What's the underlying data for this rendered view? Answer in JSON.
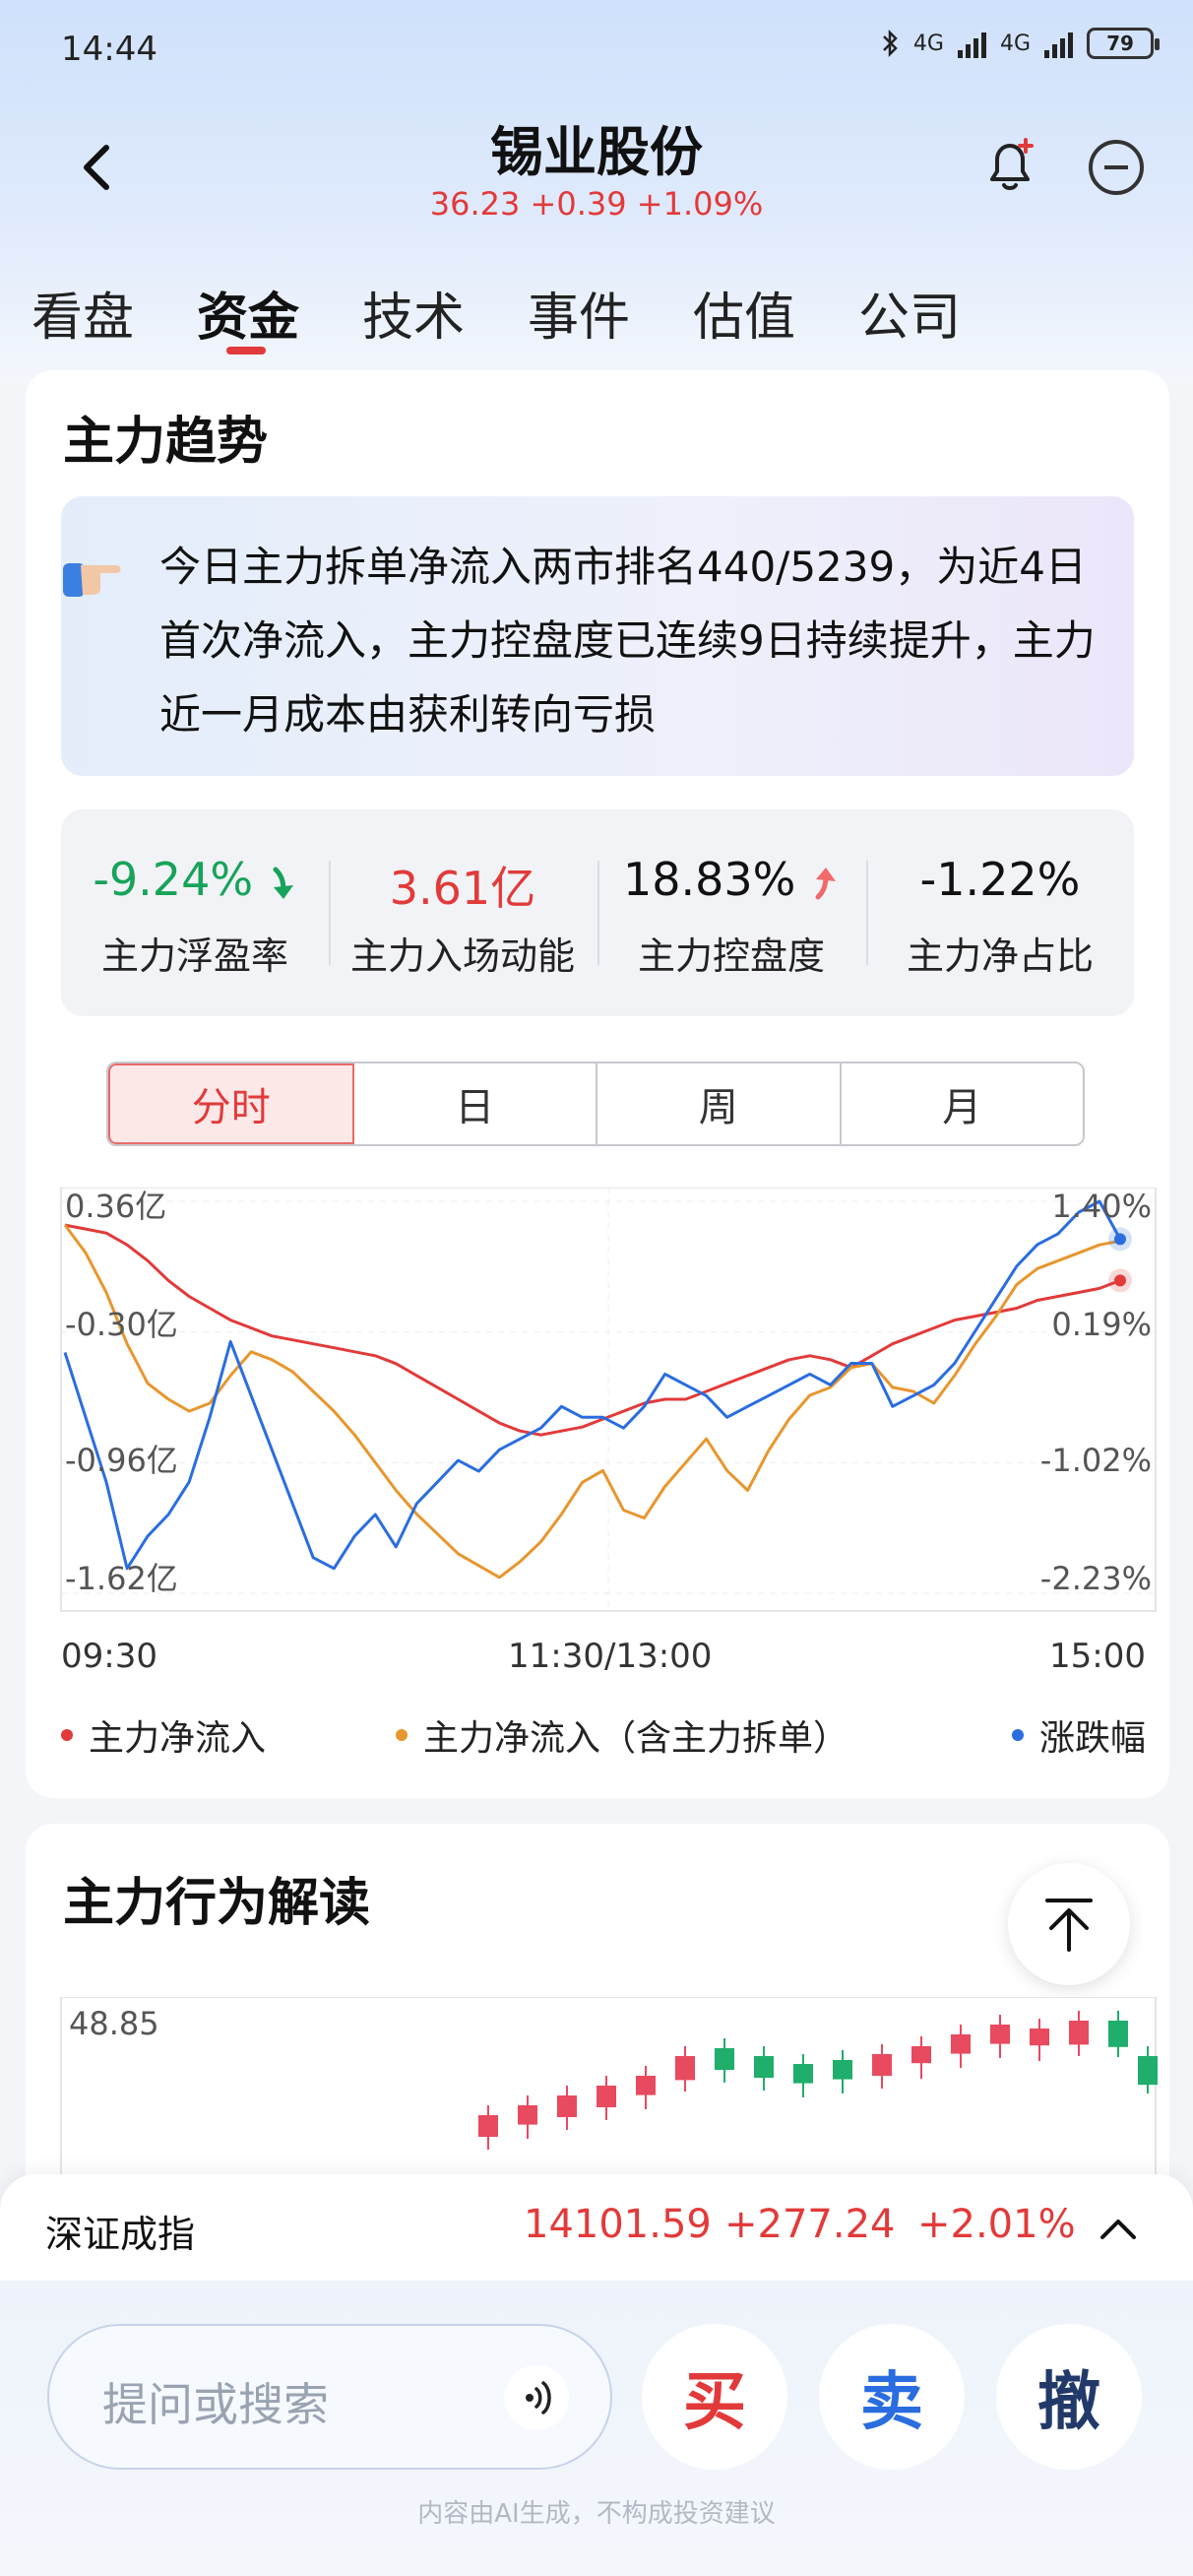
{
  "status_bar": {
    "time": "14:44",
    "battery": "79",
    "net1": "4G",
    "net2": "4G"
  },
  "header": {
    "stock_name": "锡业股份",
    "quote": "36.23 +0.39 +1.09%"
  },
  "tabs": [
    "看盘",
    "资金",
    "技术",
    "事件",
    "估值",
    "公司"
  ],
  "active_tab": "资金",
  "trend_card": {
    "title": "主力趋势",
    "insight": "今日主力拆单净流入两市排名440/5239，为近4日首次净流入，主力控盘度已连续9日持续提升，主力近一月成本由获利转向亏损",
    "metrics": [
      {
        "value": "-9.24%",
        "label": "主力浮盈率",
        "trend": "down"
      },
      {
        "value": "3.61亿",
        "label": "主力入场动能",
        "trend": "none"
      },
      {
        "value": "18.83%",
        "label": "主力控盘度",
        "trend": "up"
      },
      {
        "value": "-1.22%",
        "label": "主力净占比",
        "trend": "none"
      }
    ],
    "periods": [
      "分时",
      "日",
      "周",
      "月"
    ],
    "active_period": "分时"
  },
  "chart_data": {
    "type": "line",
    "x_labels": [
      "09:30",
      "11:30/13:00",
      "15:00"
    ],
    "y_left_ticks": [
      "0.36亿",
      "-0.30亿",
      "-0.96亿",
      "-1.62亿"
    ],
    "y_right_ticks": [
      "1.40%",
      "0.19%",
      "-1.02%",
      "-2.23%"
    ],
    "ylim_left": [
      -1.62,
      0.36
    ],
    "ylim_right": [
      -2.23,
      1.4
    ],
    "series": [
      {
        "name": "主力净流入",
        "color": "#e23a3a",
        "axis": "left",
        "values": [
          0.24,
          0.22,
          0.2,
          0.14,
          0.06,
          -0.04,
          -0.12,
          -0.18,
          -0.24,
          -0.28,
          -0.32,
          -0.34,
          -0.36,
          -0.38,
          -0.4,
          -0.42,
          -0.46,
          -0.52,
          -0.58,
          -0.64,
          -0.7,
          -0.76,
          -0.8,
          -0.82,
          -0.8,
          -0.78,
          -0.74,
          -0.7,
          -0.66,
          -0.64,
          -0.64,
          -0.6,
          -0.56,
          -0.52,
          -0.48,
          -0.44,
          -0.42,
          -0.44,
          -0.48,
          -0.42,
          -0.36,
          -0.32,
          -0.28,
          -0.24,
          -0.22,
          -0.2,
          -0.18,
          -0.14,
          -0.12,
          -0.1,
          -0.08,
          -0.04
        ]
      },
      {
        "name": "主力净流入（含主力拆单）",
        "color": "#e8962e",
        "axis": "left",
        "values": [
          0.24,
          0.1,
          -0.1,
          -0.36,
          -0.56,
          -0.64,
          -0.7,
          -0.66,
          -0.52,
          -0.4,
          -0.44,
          -0.5,
          -0.6,
          -0.7,
          -0.82,
          -0.96,
          -1.1,
          -1.22,
          -1.32,
          -1.42,
          -1.48,
          -1.54,
          -1.46,
          -1.36,
          -1.22,
          -1.06,
          -1.0,
          -1.2,
          -1.24,
          -1.08,
          -0.96,
          -0.84,
          -1.0,
          -1.1,
          -0.9,
          -0.74,
          -0.62,
          -0.58,
          -0.48,
          -0.46,
          -0.58,
          -0.6,
          -0.66,
          -0.52,
          -0.36,
          -0.22,
          -0.06,
          0.02,
          0.06,
          0.1,
          0.14,
          0.16
        ]
      },
      {
        "name": "涨跌幅",
        "color": "#2a6de0",
        "axis": "right",
        "values": [
          0.0,
          -0.6,
          -1.2,
          -2.0,
          -1.7,
          -1.5,
          -1.2,
          -0.6,
          0.1,
          -0.4,
          -0.9,
          -1.4,
          -1.9,
          -2.0,
          -1.7,
          -1.5,
          -1.8,
          -1.4,
          -1.2,
          -1.0,
          -1.1,
          -0.9,
          -0.8,
          -0.7,
          -0.5,
          -0.6,
          -0.6,
          -0.7,
          -0.5,
          -0.2,
          -0.3,
          -0.4,
          -0.6,
          -0.5,
          -0.4,
          -0.3,
          -0.2,
          -0.3,
          -0.1,
          -0.1,
          -0.5,
          -0.4,
          -0.3,
          -0.1,
          0.2,
          0.5,
          0.8,
          1.0,
          1.1,
          1.3,
          1.4,
          1.05
        ]
      }
    ],
    "legend": [
      "主力净流入",
      "主力净流入（含主力拆单）",
      "涨跌幅"
    ]
  },
  "behavior_card": {
    "title": "主力行为解读",
    "price_label": "48.85"
  },
  "index_bar": {
    "name": "深证成指",
    "value": "14101.59",
    "change": "+277.24",
    "change_pct": "+2.01%"
  },
  "bottom": {
    "search_placeholder": "提问或搜索",
    "buy": "买",
    "sell": "卖",
    "cancel": "撤",
    "disclaimer": "内容由AI生成，不构成投资建议"
  }
}
